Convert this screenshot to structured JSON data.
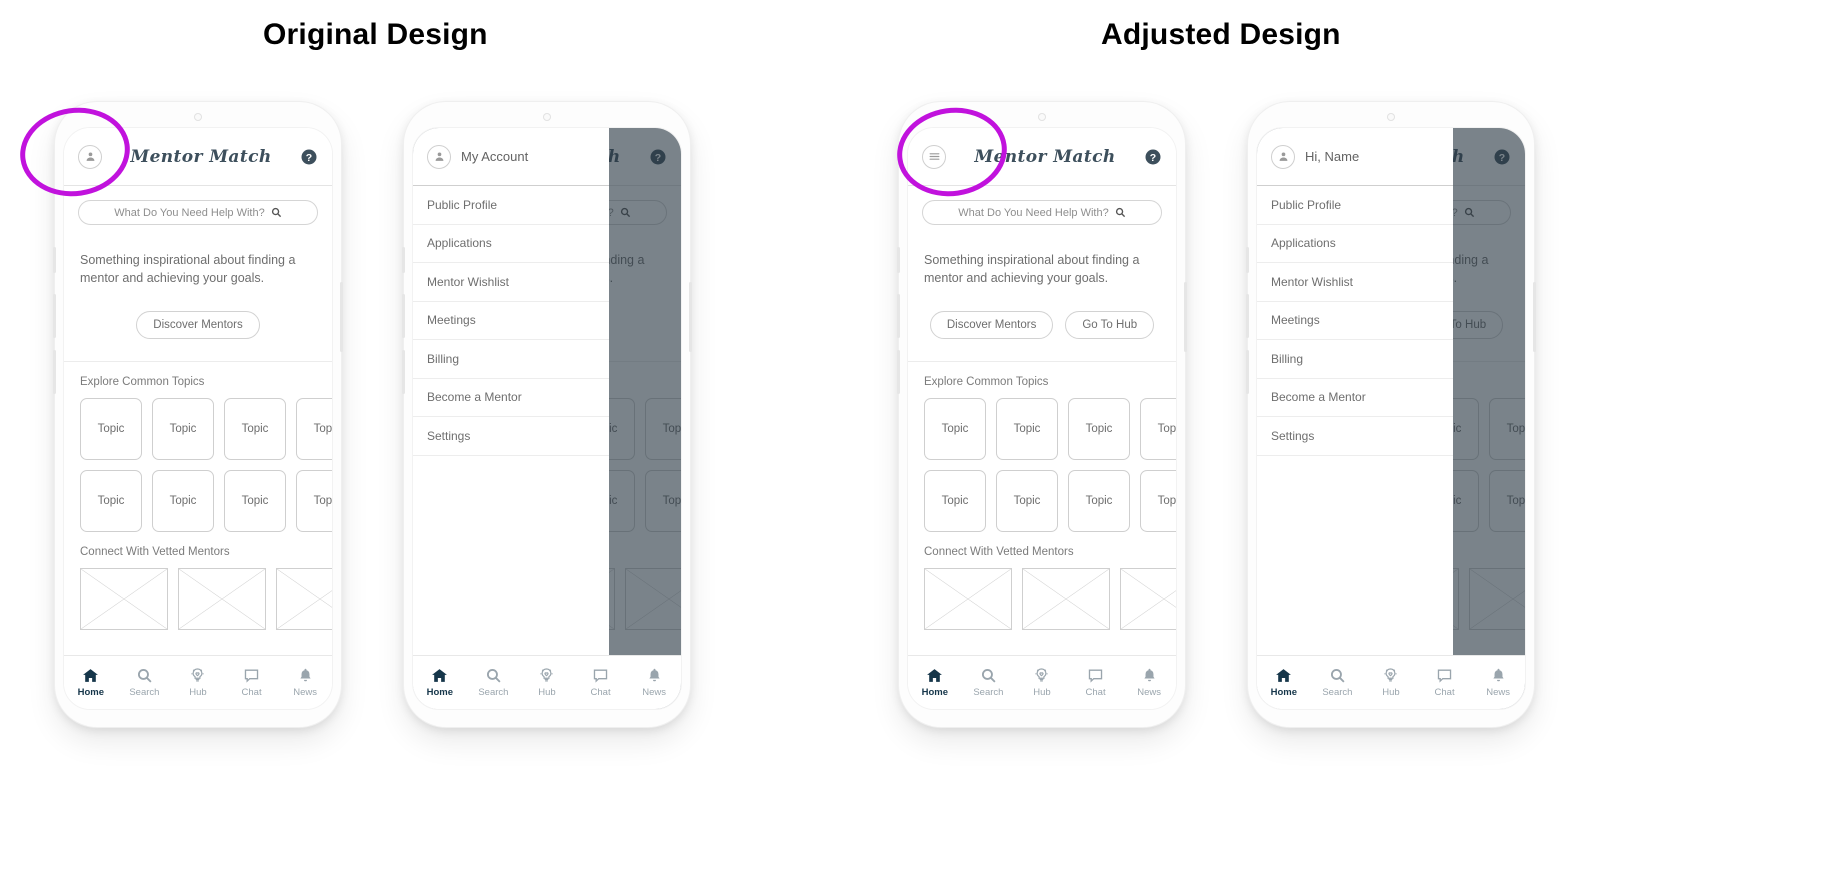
{
  "headings": {
    "original": "Original Design",
    "adjusted": "Adjusted Design"
  },
  "app": {
    "brand": "Mentor Match",
    "help_icon": "help-circle-icon",
    "search_placeholder": "What Do You Need Help With?",
    "search_icon": "search-icon",
    "hero_text": "Something inspirational about finding a mentor and achieving your goals.",
    "buttons": {
      "discover": "Discover Mentors",
      "hub": "Go To Hub"
    },
    "sections": {
      "topics": "Explore Common Topics",
      "mentors": "Connect With Vetted Mentors"
    },
    "topic_label": "Topic",
    "topic_label_clipped": "Topic",
    "bottom_nav": [
      {
        "label": "Home",
        "icon": "home-icon",
        "active": true
      },
      {
        "label": "Search",
        "icon": "search-icon",
        "active": false
      },
      {
        "label": "Hub",
        "icon": "lightbulb-heart-icon",
        "active": false
      },
      {
        "label": "Chat",
        "icon": "chat-bubble-icon",
        "active": false
      },
      {
        "label": "News",
        "icon": "bell-icon",
        "active": false
      }
    ]
  },
  "drawer": {
    "header_original": "My Account",
    "header_adjusted": "Hi, Name",
    "avatar_icon": "user-avatar-icon",
    "items": [
      "Public Profile",
      "Applications",
      "Mentor Wishlist",
      "Meetings",
      "Billing",
      "Become a Mentor",
      "Settings"
    ]
  },
  "original_screen": {
    "menu_icon": "user-avatar-icon"
  },
  "adjusted_screen": {
    "menu_icon": "hamburger-menu-icon"
  },
  "annotation": {
    "color": "#c112dd",
    "shape": "hand-drawn-circle"
  }
}
